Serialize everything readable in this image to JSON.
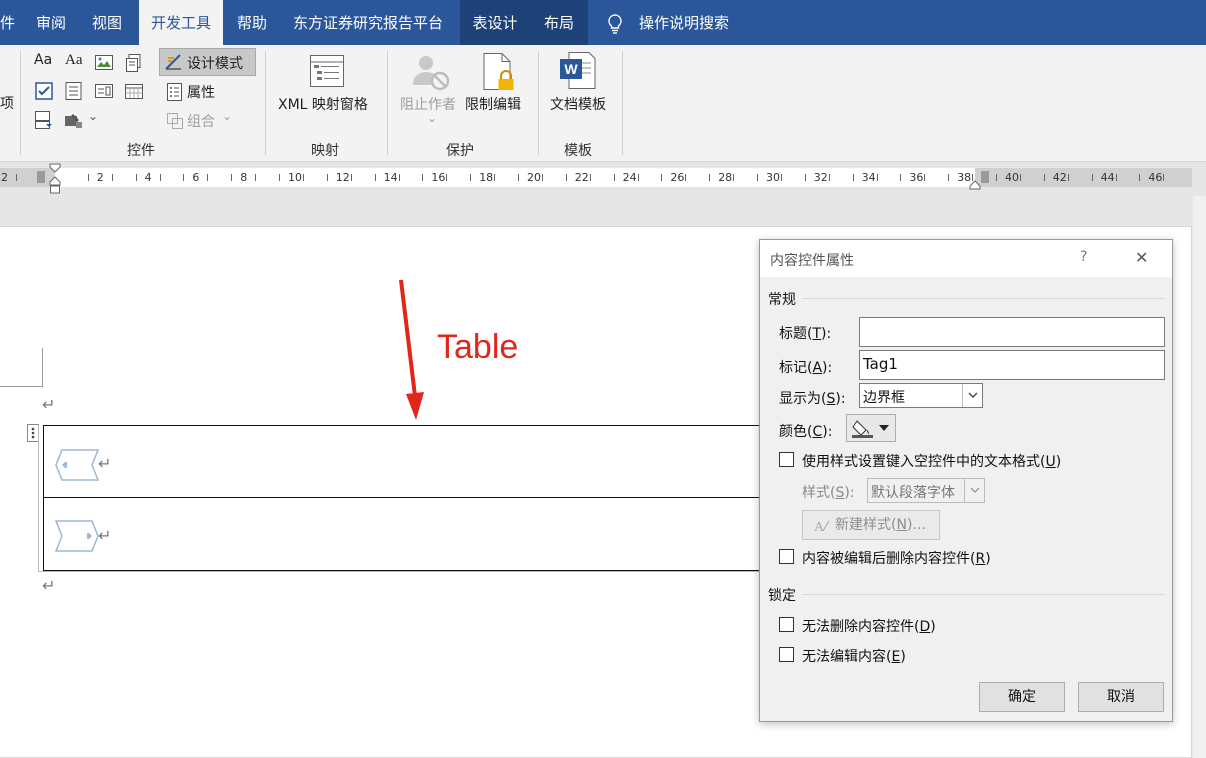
{
  "tabs": [
    {
      "label": "件"
    },
    {
      "label": "审阅"
    },
    {
      "label": "视图"
    },
    {
      "label": "开发工具"
    },
    {
      "label": "帮助"
    },
    {
      "label": "东方证券研究报告平台"
    },
    {
      "label": "表设计"
    },
    {
      "label": "布局"
    },
    {
      "label": "操作说明搜索"
    }
  ],
  "ribbon": {
    "left_fragment": "项",
    "controls": {
      "design_mode": "设计模式",
      "properties": "属性",
      "group": "组合",
      "label": "控件"
    },
    "mapping": {
      "xml_pane": "XML 映射窗格",
      "label": "映射"
    },
    "protect": {
      "block_authors": "阻止作者",
      "restrict_editing": "限制编辑",
      "label": "保护"
    },
    "templates": {
      "document_template": "文档模板",
      "label": "模板"
    }
  },
  "ruler": {
    "labels": [
      "2",
      "2",
      "4",
      "6",
      "8",
      "10",
      "12",
      "14",
      "16",
      "18",
      "20",
      "22",
      "24",
      "26",
      "28",
      "30",
      "32",
      "34",
      "36",
      "38",
      "40",
      "42",
      "44",
      "46"
    ]
  },
  "document": {
    "annotation": "Table",
    "paragraph_mark": "↵"
  },
  "dialog": {
    "title": "内容控件属性",
    "help": "?",
    "close": "✕",
    "general_section": "常规",
    "title_label": "标题(",
    "title_key": "T",
    "title_value": "",
    "tag_label": "标记(",
    "tag_key": "A",
    "tag_value": "Tag1",
    "show_as_label": "显示为(",
    "show_as_key": "S",
    "show_as_value": "边界框",
    "color_label": "颜色(",
    "color_key": "C",
    "use_style_label": "使用样式设置键入空控件中的文本格式(",
    "use_style_key": "U",
    "style_label": "样式(",
    "style_key": "S",
    "style_value": "默认段落字体",
    "new_style_label": "新建样式(",
    "new_style_key": "N",
    "remove_label": "内容被编辑后删除内容控件(",
    "remove_key": "R",
    "lock_section": "锁定",
    "no_delete_label": "无法删除内容控件(",
    "no_delete_key": "D",
    "no_edit_label": "无法编辑内容(",
    "no_edit_key": "E",
    "ok": "确定",
    "cancel": "取消"
  },
  "colors": {
    "ribbon_blue": "#2b579a",
    "annotation_red": "#e1261c"
  }
}
